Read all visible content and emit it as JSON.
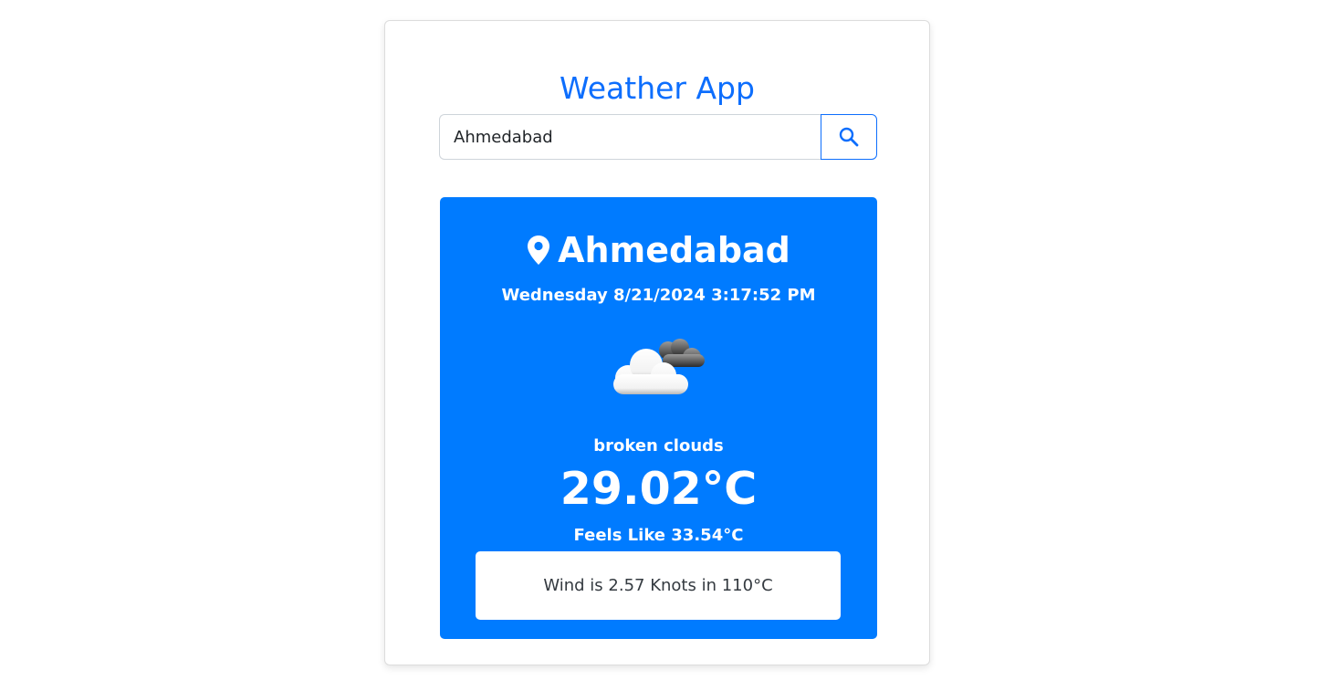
{
  "app": {
    "title": "Weather App"
  },
  "search": {
    "value": "Ahmedabad",
    "button_icon": "search-icon"
  },
  "weather": {
    "city": "Ahmedabad",
    "city_icon": "map-pin-icon",
    "datetime": "Wednesday 8/21/2024 3:17:52 PM",
    "condition_icon": "broken-clouds-icon",
    "description": "broken clouds",
    "temperature": "29.02°C",
    "feels_like": "Feels Like 33.54°C",
    "wind": "Wind is 2.57 Knots in 110°C"
  },
  "colors": {
    "accent": "#0d6efd",
    "panel": "#007bff",
    "text_on_panel": "#ffffff",
    "wind_text": "#343a40"
  }
}
